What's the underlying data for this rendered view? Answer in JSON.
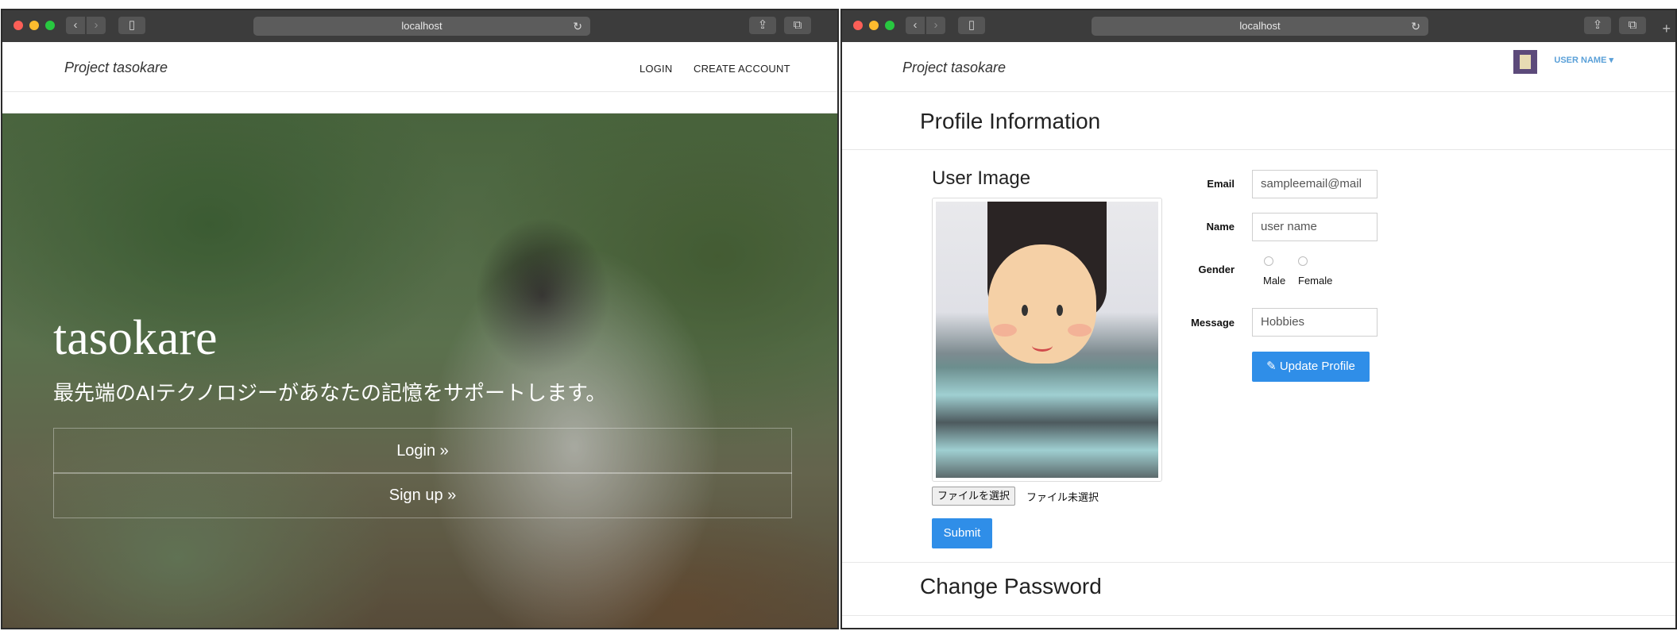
{
  "left_window": {
    "url": "localhost",
    "brand": "Project tasokare",
    "nav": {
      "login": "LOGIN",
      "create_account": "CREATE ACCOUNT"
    },
    "hero": {
      "title": "tasokare",
      "subtitle": "最先端のAIテクノロジーがあなたの記憶をサポートします。",
      "login_button": "Login »",
      "signup_button": "Sign up »"
    }
  },
  "right_window": {
    "url": "localhost",
    "brand": "Project tasokare",
    "user_menu": {
      "name": "USER NAME ▾"
    },
    "profile_section_title": "Profile Information",
    "user_image_title": "User Image",
    "file": {
      "button": "ファイルを選択",
      "status": "ファイル未選択"
    },
    "submit_label": "Submit",
    "form": {
      "email_label": "Email",
      "email_value": "sampleemail@mail",
      "name_label": "Name",
      "name_value": "user name",
      "gender_label": "Gender",
      "gender_options": [
        "Male",
        "Female"
      ],
      "message_label": "Message",
      "message_value": "Hobbies",
      "update_button": "Update Profile"
    },
    "change_password_title": "Change Password"
  },
  "icons": {
    "traffic_lights": [
      "close",
      "minimize",
      "zoom"
    ],
    "back": "chevron-left-icon",
    "forward": "chevron-right-icon",
    "sidebar": "sidebar-icon",
    "reload": "reload-icon",
    "share": "share-icon",
    "tabs": "tabs-icon",
    "pencil": "pencil-icon",
    "new_tab": "plus-icon"
  },
  "colors": {
    "accent_blue": "#2f8ee8",
    "user_name_blue": "#5aa0d8",
    "titlebar": "#3c3c3c"
  }
}
